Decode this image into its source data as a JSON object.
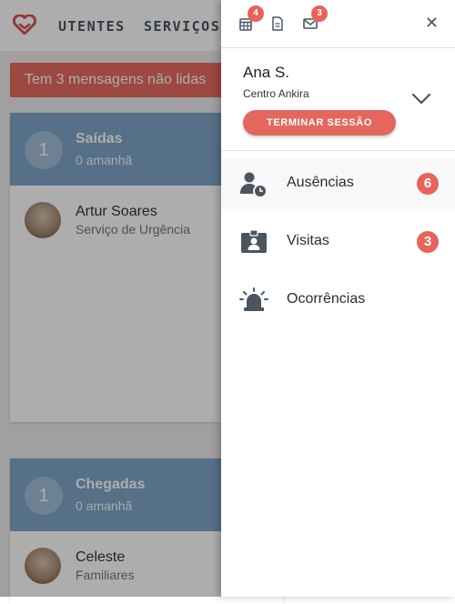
{
  "nav": {
    "items": [
      "UTENTES",
      "SERVIÇOS"
    ]
  },
  "banner": {
    "text": "Tem 3 mensagens não lidas"
  },
  "cards": [
    {
      "count": "1",
      "title": "Saídas",
      "subtitle": "0 amanhã",
      "person": {
        "name": "Artur Soares",
        "role": "Serviço de Urgência"
      }
    },
    {
      "count": "1",
      "title": "Chegadas",
      "subtitle": "0 amanhã",
      "person": {
        "name": "Celeste",
        "role": "Familiares"
      }
    }
  ],
  "drawer": {
    "top_badges": {
      "calendar": "4",
      "mail": "3"
    },
    "close_symbol": "✕",
    "user": {
      "name": "Ana S.",
      "org": "Centro Ankira"
    },
    "logout_label": "TERMINAR SESSÃO",
    "menu": [
      {
        "label": "Ausências",
        "badge": "6",
        "icon": "user-clock-icon"
      },
      {
        "label": "Visitas",
        "badge": "3",
        "icon": "id-badge-icon"
      },
      {
        "label": "Ocorrências",
        "badge": "",
        "icon": "siren-icon"
      }
    ]
  },
  "colors": {
    "accent": "#e8635a",
    "card_header": "#7ea6c8",
    "icon": "#4a5560"
  }
}
